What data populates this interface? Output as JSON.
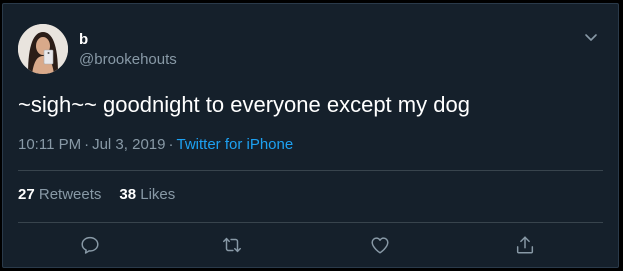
{
  "author": {
    "display_name": "b",
    "handle": "@brookehouts"
  },
  "tweet": {
    "text": "~sigh~~ goodnight to everyone except my dog",
    "time": "10:11 PM",
    "date": "Jul 3, 2019",
    "separator": "·",
    "source": "Twitter for iPhone"
  },
  "stats": {
    "retweets_count": "27",
    "retweets_label": "Retweets",
    "likes_count": "38",
    "likes_label": "Likes"
  },
  "icons": {
    "menu": "chevron-down-icon",
    "reply": "reply-icon",
    "retweet": "retweet-icon",
    "like": "heart-icon",
    "share": "share-icon"
  },
  "colors": {
    "background": "#15202b",
    "text": "#ffffff",
    "secondary": "#8899a6",
    "accent": "#1da1f2",
    "divider": "#38444d"
  }
}
